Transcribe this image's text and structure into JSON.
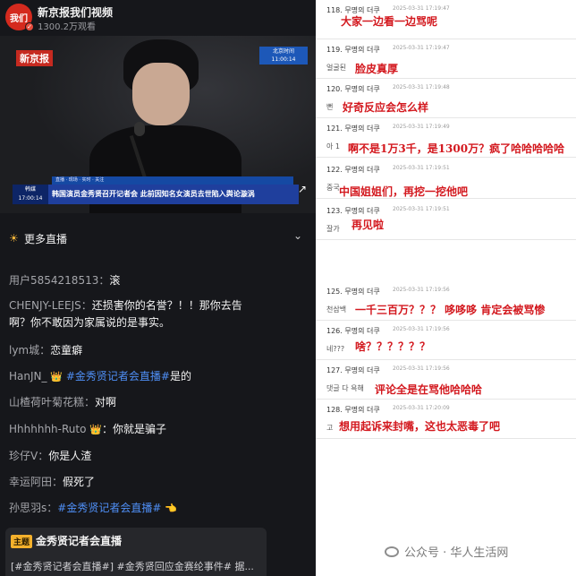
{
  "header": {
    "logo_text": "我们",
    "channel_name": "新京报我们视频",
    "viewers": "1300.2万观看"
  },
  "video": {
    "brand": "新京报",
    "time_box": [
      "北京时间",
      "11:00:14"
    ],
    "lower_third_tag": [
      "韩媒",
      "17:00:14"
    ],
    "lower_third_strip": "直播 · 现场 · 实时 · 关注",
    "lower_third_title": "韩国演员金秀贤召开记者会  此前因知名女演员去世陷入舆论漩涡",
    "watermark": "↗"
  },
  "more_live": {
    "label": "更多直播",
    "icon": "sun-icon",
    "chevron": "chevron-down-icon"
  },
  "comments": [
    {
      "user": "用户5854218513：",
      "text": "滚"
    },
    {
      "user": "CHENJY-LEEJS：",
      "text": "还损害你的名誉？！！那你去告"
    },
    {
      "user": "",
      "text": "啊？你不敢因为家属说的是事实。"
    },
    {
      "user": "lym城：",
      "text": "恋童癖"
    },
    {
      "user": "HanJN_",
      "emoji": "👑",
      "tag": "#金秀贤记者会直播#",
      "text": "是的"
    },
    {
      "user": "山楂荷叶菊花糕：",
      "text": "对啊"
    },
    {
      "user": "Hhhhhhh-Ruto",
      "emoji": "👑",
      "text": "：你就是骗子"
    },
    {
      "user": "珍仔V：",
      "text": "你是人渣"
    },
    {
      "user": "幸运阿田：",
      "text": "假死了"
    },
    {
      "user": "孙思羽s：",
      "tag": "#金秀贤记者会直播#",
      "emoji": "👈"
    }
  ],
  "live_card": {
    "badge": "主题",
    "title": "金秀贤记者会直播",
    "sub": "[#金秀贤记者会直播#] #金秀贤回应金赛纶事件# 据..."
  },
  "rows": [
    {
      "num": "118. 무명의 더쿠",
      "date": "2025-03-31 17:19:47",
      "nick": "",
      "overlay": "大家一边看一边骂呢"
    },
    {
      "num": "119. 무명의 더쿠",
      "date": "2025-03-31 17:19:47",
      "nick": "얼굴된",
      "overlay": "脸皮真厚"
    },
    {
      "num": "120. 무명의 더쿠",
      "date": "2025-03-31 17:19:48",
      "nick": "뻔",
      "overlay": "好奇反应会怎么样"
    },
    {
      "num": "121. 무명의 더쿠",
      "date": "2025-03-31 17:19:49",
      "nick": "아 1",
      "overlay": "啊不是1万3千，是1300万？疯了哈哈哈哈哈"
    },
    {
      "num": "122. 무명의 더쿠",
      "date": "2025-03-31 17:19:51",
      "nick": "중국",
      "overlay": "中国姐姐们，再挖一挖他吧"
    },
    {
      "num": "123. 무명의 더쿠",
      "date": "2025-03-31 17:19:51",
      "nick": "잘가",
      "overlay": "再见啦"
    },
    {
      "num": "125. 무명의 더쿠",
      "date": "2025-03-31 17:19:56",
      "nick": "천삼백",
      "overlay": "一千三百万？？？ 哆哆哆 肯定会被骂惨"
    },
    {
      "num": "126. 무명의 더쿠",
      "date": "2025-03-31 17:19:56",
      "nick": "네???",
      "overlay": "啥？？？？？？"
    },
    {
      "num": "127. 무명의 더쿠",
      "date": "2025-03-31 17:19:56",
      "nick": "댓글 다 욕해",
      "overlay": "评论全是在骂他哈哈哈"
    },
    {
      "num": "128. 무명의 더쿠",
      "date": "2025-03-31 17:20:09",
      "nick": "고",
      "overlay": "想用起诉来封嘴，这也太恶毒了吧"
    }
  ],
  "watermark": "公众号 · 华人生活网"
}
